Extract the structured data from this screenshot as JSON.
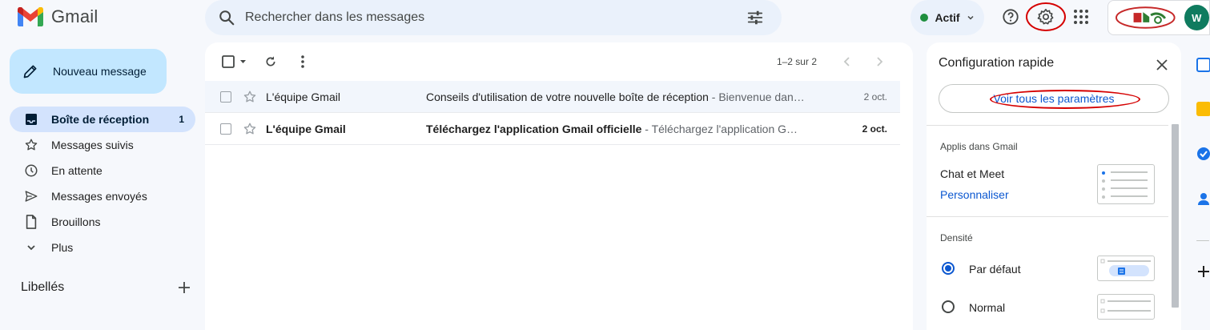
{
  "app": {
    "name": "Gmail"
  },
  "search": {
    "placeholder": "Rechercher dans les messages"
  },
  "header": {
    "status_label": "Actif",
    "avatar_initial": "W"
  },
  "sidebar": {
    "compose_label": "Nouveau message",
    "items": [
      {
        "label": "Boîte de réception",
        "count": "1",
        "icon": "inbox-icon",
        "active": true
      },
      {
        "label": "Messages suivis",
        "count": "",
        "icon": "star-icon"
      },
      {
        "label": "En attente",
        "count": "",
        "icon": "clock-icon"
      },
      {
        "label": "Messages envoyés",
        "count": "",
        "icon": "send-icon"
      },
      {
        "label": "Brouillons",
        "count": "",
        "icon": "draft-icon"
      },
      {
        "label": "Plus",
        "count": "",
        "icon": "chevron-down-icon"
      }
    ],
    "labels_heading": "Libellés"
  },
  "main": {
    "pager": "1–2 sur 2",
    "emails": [
      {
        "sender": "L'équipe Gmail",
        "subject": "Conseils d'utilisation de votre nouvelle boîte de réception",
        "snippet": " - Bienvenue dan…",
        "date": "2 oct.",
        "unread": false
      },
      {
        "sender": "L'équipe Gmail",
        "subject": "Téléchargez l'application Gmail officielle",
        "snippet": " - Téléchargez l'application G…",
        "date": "2 oct.",
        "unread": true
      }
    ]
  },
  "quick_settings": {
    "title": "Configuration rapide",
    "see_all": "Voir tous les paramètres",
    "apps_heading": "Applis dans Gmail",
    "apps_item": "Chat et Meet",
    "apps_link": "Personnaliser",
    "density_heading": "Densité",
    "density_options": [
      {
        "label": "Par défaut",
        "selected": true
      },
      {
        "label": "Normal",
        "selected": false
      }
    ]
  },
  "colors": {
    "accent": "#0b57d0",
    "compose_bg": "#c2e7ff",
    "active_nav": "#d3e3fd",
    "annotation": "#d50000"
  }
}
